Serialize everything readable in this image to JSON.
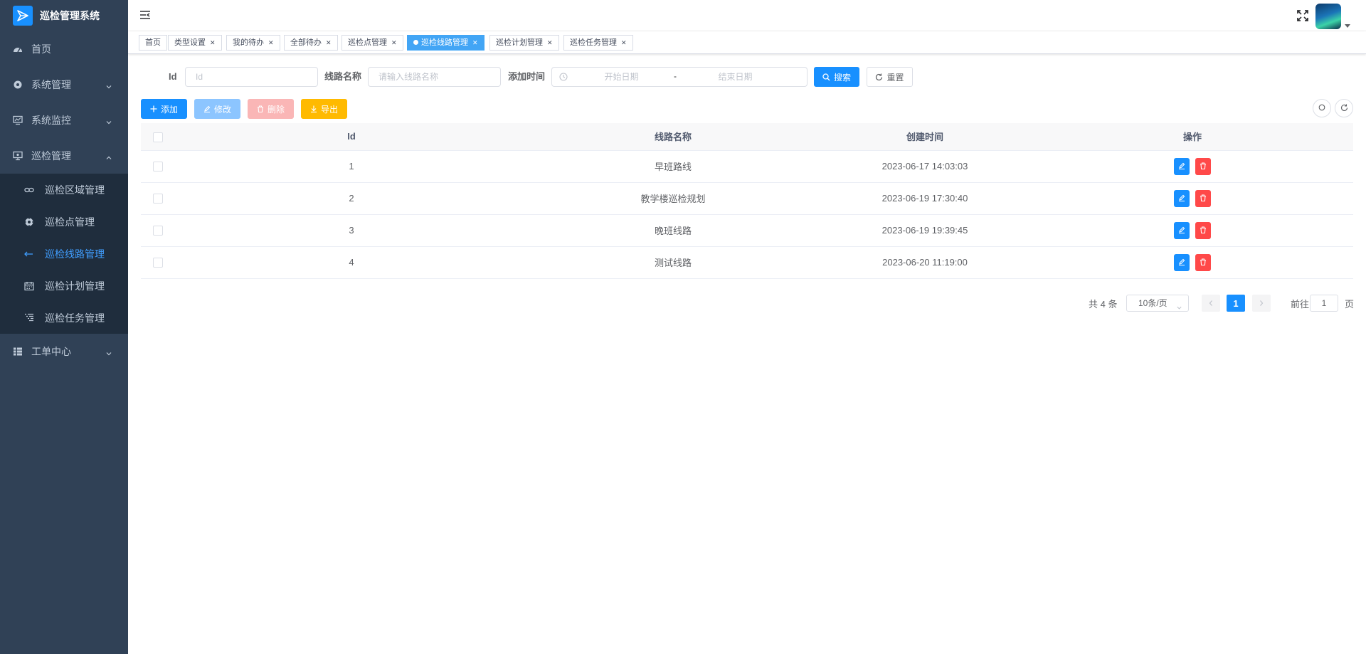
{
  "app": {
    "title": "巡检管理系统"
  },
  "sidebar": {
    "items": [
      {
        "label": "首页",
        "icon": "dashboard-icon"
      },
      {
        "label": "系统管理",
        "icon": "gear-icon"
      },
      {
        "label": "系统监控",
        "icon": "monitor-icon"
      },
      {
        "label": "巡检管理",
        "icon": "inspection-icon"
      }
    ],
    "sub_items": [
      {
        "label": "巡检区域管理",
        "icon": "link-icon"
      },
      {
        "label": "巡检点管理",
        "icon": "target-icon"
      },
      {
        "label": "巡检线路管理",
        "icon": "route-icon"
      },
      {
        "label": "巡检计划管理",
        "icon": "calendar-icon"
      },
      {
        "label": "巡检任务管理",
        "icon": "list-icon"
      }
    ],
    "bottom_item": {
      "label": "工单中心",
      "icon": "tree-table-icon"
    },
    "active_color": "#409eff",
    "background": "#304156"
  },
  "tags": [
    {
      "label": "首页"
    },
    {
      "label": "类型设置"
    },
    {
      "label": "我的待办"
    },
    {
      "label": "全部待办"
    },
    {
      "label": "巡检点管理"
    },
    {
      "label": "巡检线路管理"
    },
    {
      "label": "巡检计划管理"
    },
    {
      "label": "巡检任务管理"
    }
  ],
  "search": {
    "id_label": "Id",
    "id_placeholder": "Id",
    "name_label": "线路名称",
    "name_placeholder": "请输入线路名称",
    "time_label": "添加时间",
    "start_placeholder": "开始日期",
    "end_placeholder": "结束日期",
    "range_separator": "-",
    "search_button": "搜索",
    "reset_button": "重置"
  },
  "toolbar": {
    "add": "添加",
    "edit": "修改",
    "delete": "删除",
    "export": "导出"
  },
  "table": {
    "columns": [
      "Id",
      "线路名称",
      "创建时间",
      "操作"
    ],
    "rows": [
      {
        "id": "1",
        "name": "早班路线",
        "created": "2023-06-17 14:03:03"
      },
      {
        "id": "2",
        "name": "教学楼巡检规划",
        "created": "2023-06-19 17:30:40"
      },
      {
        "id": "3",
        "name": "晚班线路",
        "created": "2023-06-19 19:39:45"
      },
      {
        "id": "4",
        "name": "测试线路",
        "created": "2023-06-20 11:19:00"
      }
    ]
  },
  "pagination": {
    "total": "共 4 条",
    "page_size": "10条/页",
    "current_page": "1",
    "goto_label": "前往",
    "goto_value": "1",
    "page_unit": "页"
  },
  "colors": {
    "primary": "#1890ff",
    "danger": "#ff4949",
    "warning": "#ffba00",
    "active_tag": "#42a5f5"
  }
}
